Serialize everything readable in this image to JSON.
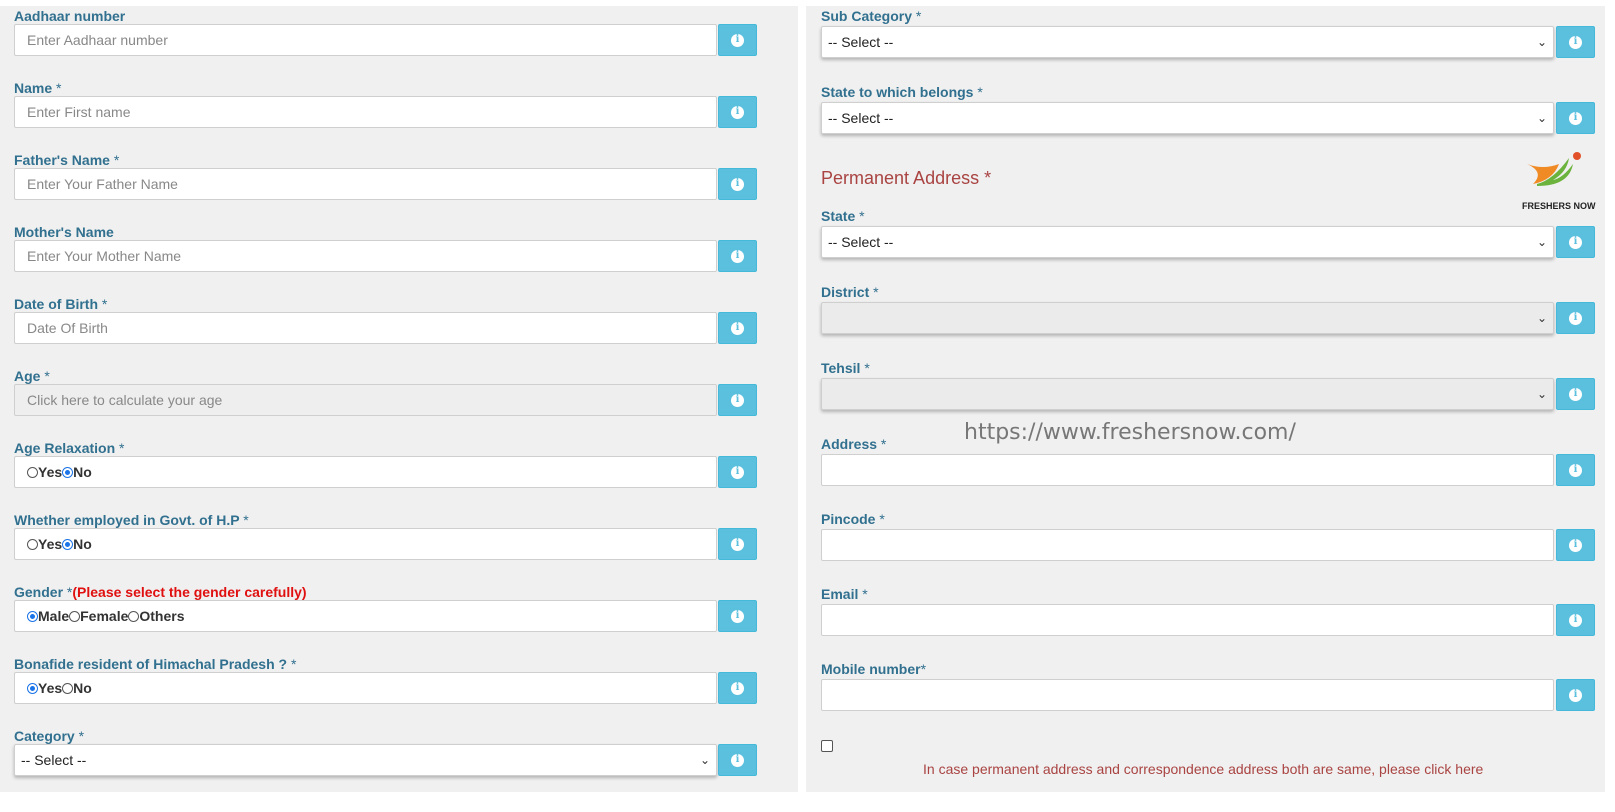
{
  "left_form": {
    "aadhaar": {
      "label": "Aadhaar number",
      "placeholder": "Enter Aadhaar number"
    },
    "name": {
      "label": "Name",
      "required": "*",
      "placeholder": "Enter First name"
    },
    "father": {
      "label": "Father's Name",
      "required": "*",
      "placeholder": "Enter Your Father Name"
    },
    "mother": {
      "label": "Mother's Name",
      "placeholder": "Enter Your Mother Name"
    },
    "dob": {
      "label": "Date of Birth",
      "required": "*",
      "placeholder": "Date Of Birth"
    },
    "age": {
      "label": "Age",
      "required": "*",
      "placeholder": "Click here to  calculate your age"
    },
    "age_relaxation": {
      "label": "Age Relaxation",
      "required": "*",
      "options": [
        "Yes",
        "No"
      ],
      "selected": "No"
    },
    "employed": {
      "label": "Whether employed in Govt. of H.P",
      "required": "*",
      "options": [
        "Yes",
        "No"
      ],
      "selected": "No"
    },
    "gender": {
      "label": "Gender",
      "required": "*",
      "warning": "(Please select the gender carefully)",
      "options": [
        "Male",
        "Female",
        "Others"
      ],
      "selected": "Male"
    },
    "bonafide": {
      "label": "Bonafide resident of Himachal Pradesh ?",
      "required": "*",
      "options": [
        "Yes",
        "No"
      ],
      "selected": "Yes"
    },
    "category": {
      "label": "Category",
      "required": "*",
      "value": "-- Select --"
    }
  },
  "right_form": {
    "sub_category": {
      "label": "Sub Category",
      "required": "*",
      "value": "-- Select --"
    },
    "state_belongs": {
      "label": "State to which belongs",
      "required": "*",
      "value": "-- Select --"
    },
    "permanent_address_title": "Permanent Address *",
    "state": {
      "label": "State",
      "required": "*",
      "value": "-- Select --"
    },
    "district": {
      "label": "District",
      "required": "*",
      "value": ""
    },
    "tehsil": {
      "label": "Tehsil",
      "required": "*",
      "value": ""
    },
    "address": {
      "label": "Address",
      "required": "*",
      "value": ""
    },
    "pincode": {
      "label": "Pincode",
      "required": "*",
      "value": ""
    },
    "email": {
      "label": "Email",
      "required": "*",
      "value": ""
    },
    "mobile": {
      "label": "Mobile number",
      "required": "*",
      "value": ""
    },
    "same_address_note": "In case permanent address and correspondence address both are same, please click here"
  },
  "watermark": "https://www.freshersnow.com/",
  "logo": {
    "text": "FRESHERS NOW"
  },
  "icons": {
    "info": "info-icon",
    "dropdown": "chevron-down-icon"
  },
  "colors": {
    "label": "#31708f",
    "info_button": "#5bc0de",
    "section_title": "#a94442",
    "warning": "#e01010"
  }
}
